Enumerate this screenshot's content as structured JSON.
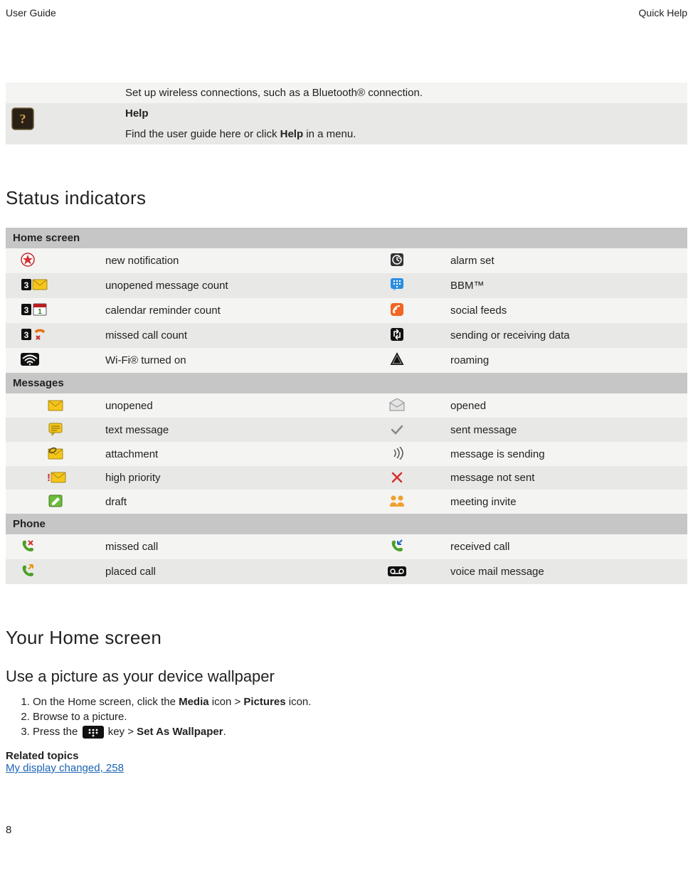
{
  "header": {
    "left": "User Guide",
    "right": "Quick Help"
  },
  "intro": {
    "setup": "Set up wireless connections, such as a Bluetooth® connection.",
    "help_title": "Help",
    "help_body_pre": "Find the user guide here or click ",
    "help_body_bold": "Help",
    "help_body_post": " in a menu."
  },
  "section1": {
    "title": "Status indicators",
    "groups": {
      "home": {
        "header": "Home screen",
        "rows": [
          {
            "l": "new notification",
            "r": "alarm set"
          },
          {
            "l": "unopened message count",
            "r": "BBM™"
          },
          {
            "l": "calendar reminder count",
            "r": "social feeds"
          },
          {
            "l": "missed call count",
            "r": "sending or receiving data"
          },
          {
            "l": "Wi-Fi® turned on",
            "r": "roaming"
          }
        ]
      },
      "messages": {
        "header": "Messages",
        "rows": [
          {
            "l": "unopened",
            "r": "opened"
          },
          {
            "l": "text message",
            "r": "sent message"
          },
          {
            "l": "attachment",
            "r": "message is sending"
          },
          {
            "l": "high priority",
            "r": "message not sent"
          },
          {
            "l": "draft",
            "r": "meeting invite"
          }
        ]
      },
      "phone": {
        "header": "Phone",
        "rows": [
          {
            "l": "missed call",
            "r": "received call"
          },
          {
            "l": "placed call",
            "r": "voice mail message"
          }
        ]
      }
    }
  },
  "section2": {
    "title": "Your Home screen",
    "sub_title": "Use a picture as your device wallpaper",
    "steps": {
      "s1_pre": "On the Home screen, click the ",
      "s1_b1": "Media",
      "s1_mid": " icon > ",
      "s1_b2": "Pictures",
      "s1_post": " icon.",
      "s2": "Browse to a picture.",
      "s3_pre": "Press the ",
      "s3_mid": " key > ",
      "s3_b": "Set As Wallpaper",
      "s3_post": "."
    },
    "related_label": "Related topics",
    "related_link": "My display changed, 258"
  },
  "page_number": "8"
}
